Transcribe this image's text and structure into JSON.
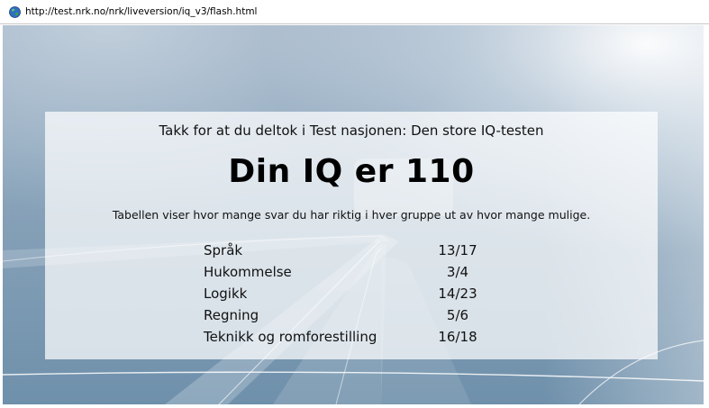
{
  "browser": {
    "url": "http://test.nrk.no/nrk/liveversion/iq_v3/flash.html",
    "favicon": "globe-icon"
  },
  "result": {
    "thanks_text": "Takk for at du deltok i Test nasjonen: Den store IQ-testen",
    "iq_heading": "Din IQ er 110",
    "description": "Tabellen viser hvor mange svar du har riktig i hver gruppe ut av hvor mange mulige.",
    "rows": [
      {
        "category": "Språk",
        "score": "13/17"
      },
      {
        "category": "Hukommelse",
        "score": "3/4"
      },
      {
        "category": "Logikk",
        "score": "14/23"
      },
      {
        "category": "Regning",
        "score": "5/6"
      },
      {
        "category": "Teknikk og romforestilling",
        "score": "16/18"
      }
    ]
  },
  "colors": {
    "background_light": "#c9d6e2",
    "background_dark": "#6f90ab",
    "panel": "#ffffff",
    "text": "#111111"
  }
}
